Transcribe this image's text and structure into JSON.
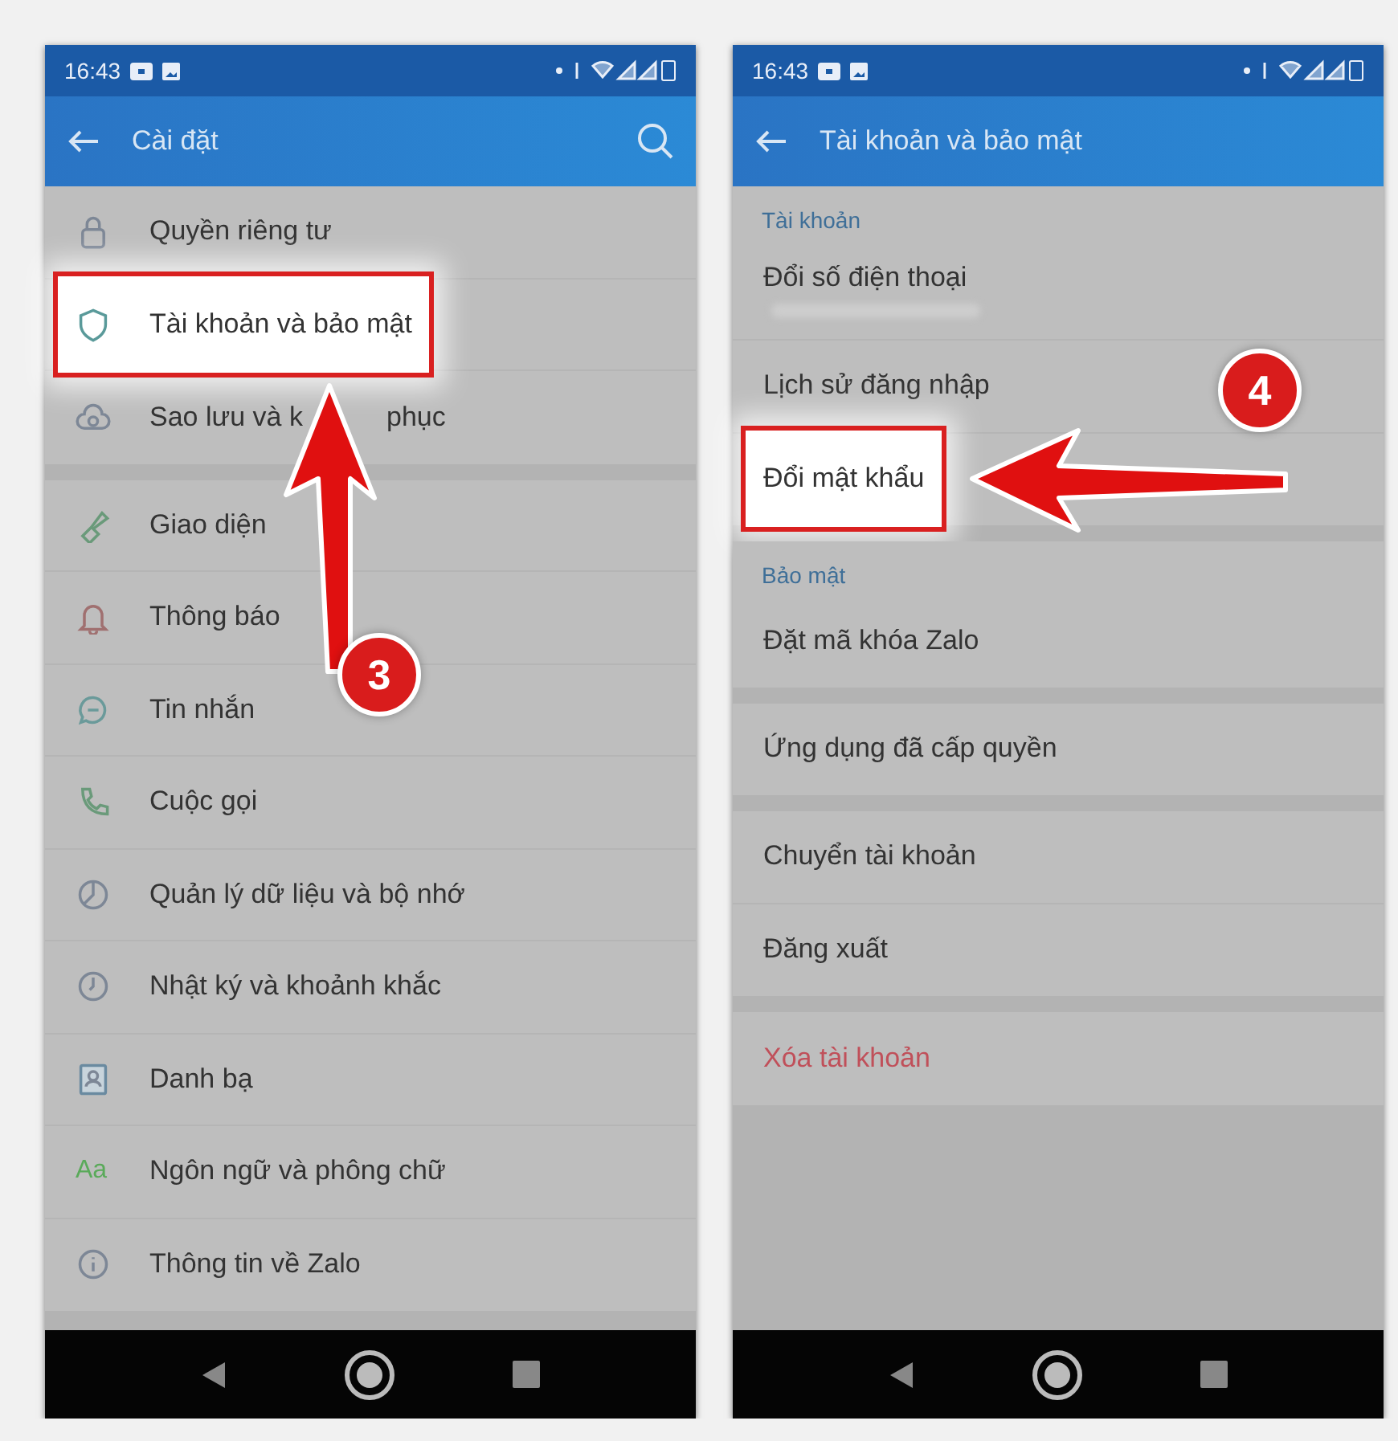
{
  "phones": [
    {
      "status_bar": {
        "time": "16:43"
      },
      "app_bar": {
        "title": "Cài đặt",
        "search": true
      },
      "groups": [
        {
          "items": [
            {
              "label": "Quyền riêng tư",
              "highlighted": false
            },
            {
              "label": "Tài khoản và bảo mật",
              "highlighted": true
            },
            {
              "label_parts": [
                "Sao lưu và k",
                "phục"
              ],
              "highlighted": false
            }
          ]
        },
        {
          "items": [
            {
              "label": "Giao diện",
              "highlighted": false
            },
            {
              "label": "Thông báo",
              "highlighted": false
            },
            {
              "label": "Tin nhắn",
              "highlighted": false
            },
            {
              "label": "Cuộc gọi",
              "highlighted": false
            },
            {
              "label": "Quản lý dữ liệu và bộ nhớ",
              "highlighted": false
            },
            {
              "label": "Nhật ký và khoảnh khắc",
              "highlighted": false
            },
            {
              "label": "Danh bạ",
              "highlighted": false
            },
            {
              "label": "Ngôn ngữ và phông chữ",
              "highlighted": false,
              "icon_text": "Aa"
            },
            {
              "label": "Thông tin về Zalo",
              "highlighted": false
            }
          ]
        }
      ],
      "annotation": {
        "step": "3",
        "kind": "up"
      }
    },
    {
      "status_bar": {
        "time": "16:43"
      },
      "app_bar": {
        "title": "Tài khoản và bảo mật",
        "search": false
      },
      "groups": [
        {
          "header": "Tài khoản",
          "items": [
            {
              "label": "Đổi số điện thoại",
              "highlighted": false,
              "masked_subtitle": true
            },
            {
              "label": "Lịch sử đăng nhập",
              "highlighted": false
            },
            {
              "label": "Đổi mật khẩu",
              "highlighted": true
            }
          ]
        },
        {
          "header": "Bảo mật",
          "items": [
            {
              "label": "Đặt mã khóa Zalo",
              "highlighted": false
            }
          ]
        },
        {
          "items": [
            {
              "label": "Ứng dụng đã cấp quyền",
              "highlighted": false
            }
          ]
        },
        {
          "items": [
            {
              "label": "Chuyển tài khoản",
              "highlighted": false
            },
            {
              "label": "Đăng xuất",
              "highlighted": false
            }
          ]
        },
        {
          "items": [
            {
              "label": "Xóa tài khoản",
              "highlighted": false,
              "kind": "destructive"
            }
          ]
        }
      ],
      "annotation": {
        "step": "4",
        "kind": "left"
      }
    }
  ]
}
